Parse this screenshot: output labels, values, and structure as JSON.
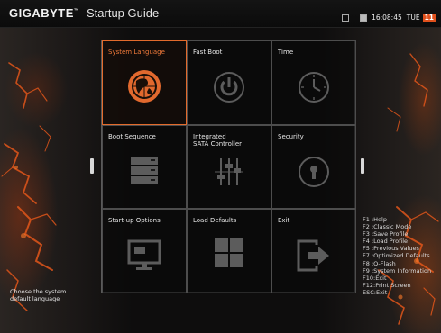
{
  "brand": {
    "logo": "GIGABYTE",
    "trademark": "™"
  },
  "window": {
    "title": "Startup Guide"
  },
  "status": {
    "icons": [
      "screen-icon",
      "grid-icon",
      "keyboard-icon"
    ],
    "time": "16:08:45",
    "day": "TUE",
    "date": "11"
  },
  "tiles": [
    {
      "label": "System Language",
      "icon": "globe-icon",
      "selected": true
    },
    {
      "label": "Fast Boot",
      "icon": "power-icon",
      "selected": false
    },
    {
      "label": "Time",
      "icon": "clock-icon",
      "selected": false
    },
    {
      "label": "Boot Sequence",
      "icon": "server-icon",
      "selected": false
    },
    {
      "label": "Integrated\nSATA Controller",
      "icon": "sliders-icon",
      "selected": false
    },
    {
      "label": "Security",
      "icon": "lock-icon",
      "selected": false
    },
    {
      "label": "Start-up Options",
      "icon": "monitor-icon",
      "selected": false
    },
    {
      "label": "Load Defaults",
      "icon": "windows-icon",
      "selected": false
    },
    {
      "label": "Exit",
      "icon": "exit-icon",
      "selected": false
    }
  ],
  "hint": "Choose the system\ndefault language",
  "hotkeys": [
    "F1 :Help",
    "F2 :Classic Mode",
    "F3 :Save Profile",
    "F4 :Load Profile",
    "F5 :Previous Values",
    "F7 :Optimized Defaults",
    "F8 :Q-Flash",
    "F9 :System Information",
    "F10:Exit",
    "F12:Print Screen",
    "ESC:Exit"
  ],
  "colors": {
    "accent": "#e36b2c",
    "grid_border": "#4d4d4d",
    "icon_gray": "#5c5c5c",
    "text": "#e6e6e6"
  }
}
